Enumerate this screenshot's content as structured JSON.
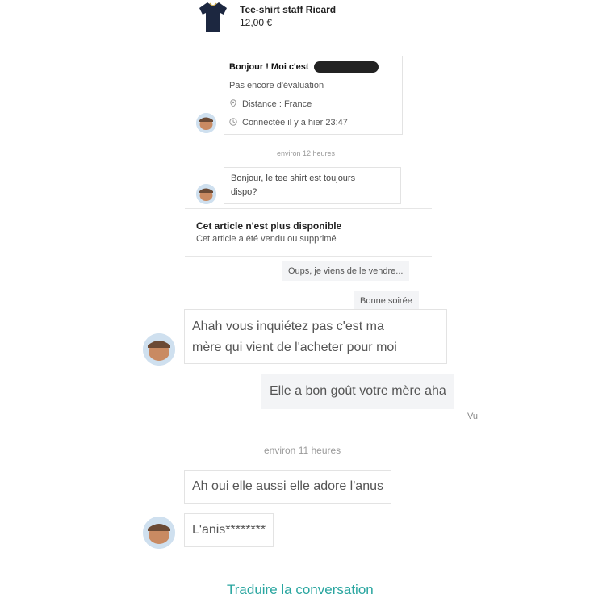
{
  "product": {
    "title": "Tee-shirt staff Ricard",
    "price": "12,00 €"
  },
  "profile": {
    "greeting": "Bonjour ! Moi c'est",
    "rating": "Pas encore d'évaluation",
    "distance": "Distance : France",
    "last_seen": "Connectée il y a hier 23:47",
    "icons": [
      "location-pin-icon",
      "clock-icon"
    ]
  },
  "messages": {
    "time_1": "environ 12 heures",
    "first_question": [
      "Bonjour, le tee shirt est toujours",
      "dispo?"
    ],
    "system_title": "Cet article n'est plus disponible",
    "system_subtitle": "Cet article a été vendu ou supprimé",
    "reply_1": "Oups, je viens de le vendre...",
    "reply_2": "Bonne soirée",
    "buyer_1": [
      "Ahah vous inquiétez pas c'est ma",
      "mère qui vient de l'acheter pour moi"
    ],
    "reply_3": "Elle a bon goût votre mère aha",
    "seen": "Vu",
    "time_2": "environ 11 heures",
    "buyer_2": "Ah oui elle aussi elle adore l'anus",
    "buyer_3": "L'anis********"
  },
  "footer": {
    "translate": "Traduire la conversation"
  },
  "colors": {
    "accent": "#2aa6a0",
    "bubble_me": "#f3f4f6",
    "border": "#e3e3e3"
  }
}
